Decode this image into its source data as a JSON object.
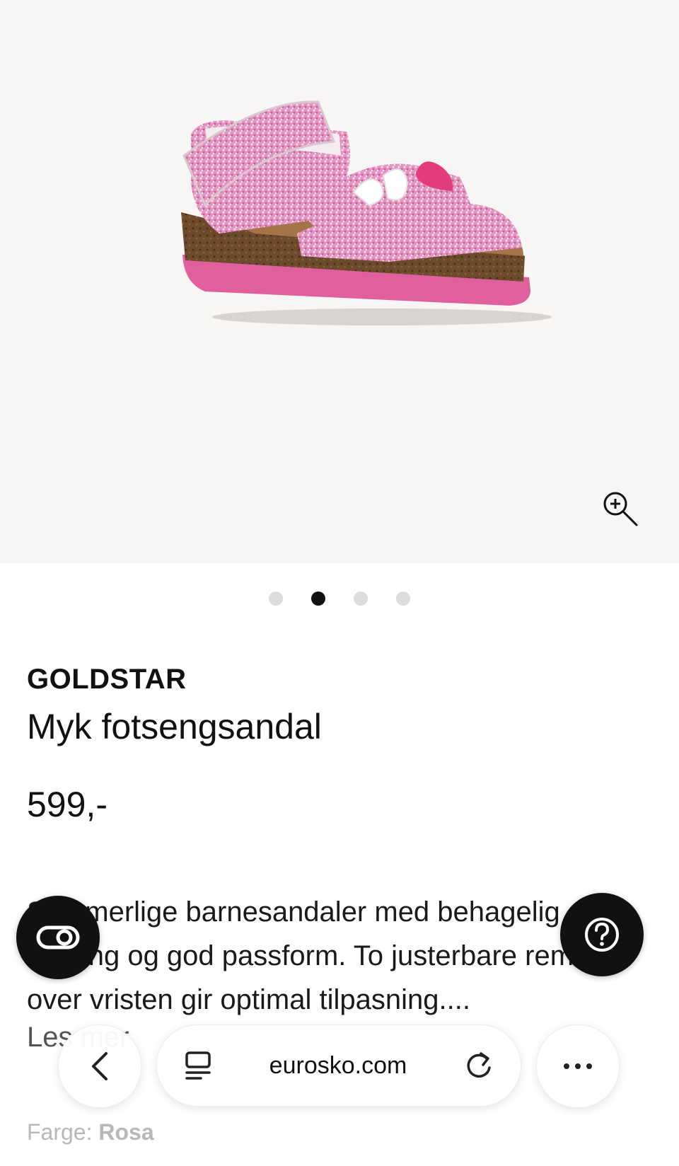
{
  "gallery": {
    "image_alt": "Pink glitter children's sandal",
    "zoom_icon": "zoom-in-icon",
    "dots": [
      {
        "active": false
      },
      {
        "active": true
      },
      {
        "active": false
      },
      {
        "active": false
      }
    ]
  },
  "product": {
    "brand": "GOLDSTAR",
    "name": "Myk fotsengsandal",
    "price": "599,-",
    "description": "Sommerlige barnesandaler med behagelig fotseng og god passform. To justerbare remmer over vristen gir optimal tilpasning....",
    "read_more": "Les mer",
    "color_label": "Farge:",
    "color_value": "Rosa"
  },
  "floating": {
    "left_icon": "toggle-icon",
    "right_icon": "help-icon"
  },
  "browser": {
    "url": "eurosko.com",
    "back_icon": "chevron-left-icon",
    "tabs_icon": "reader-icon",
    "reload_icon": "reload-icon",
    "more_icon": "more-horizontal-icon"
  },
  "colors": {
    "gallery_bg": "#f8f6f4",
    "sandal_pink": "#e07ab0",
    "sole_pink": "#e0609e",
    "cork": "#7a5232",
    "fab_bg": "#111111"
  }
}
